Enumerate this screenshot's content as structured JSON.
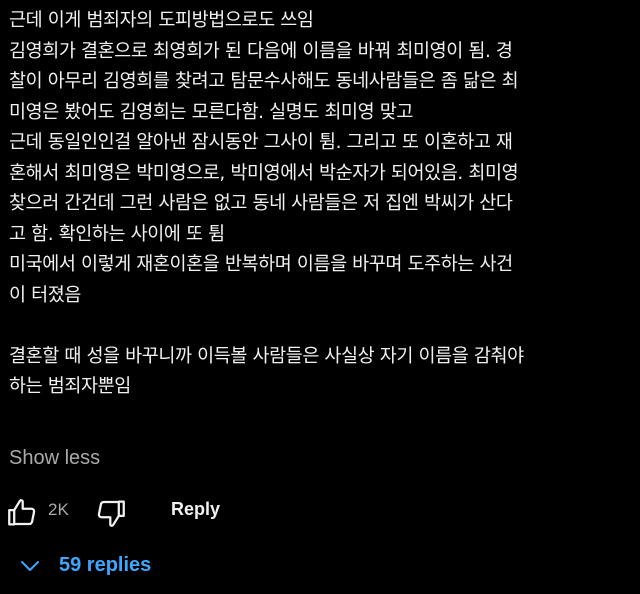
{
  "comment": {
    "lines": [
      "근데 이게 범죄자의 도피방법으로도 쓰임",
      "김영희가 결혼으로 최영희가 된 다음에 이름을 바꿔 최미영이 됨. 경",
      "찰이 아무리 김영희를 찾려고 탐문수사해도 동네사람들은 좀 닮은 최",
      "미영은 봤어도 김영희는 모른다함. 실명도 최미영 맞고",
      "근데 동일인인걸 알아낸 잠시동안 그사이 튐. 그리고 또 이혼하고 재",
      "혼해서 최미영은 박미영으로, 박미영에서 박순자가 되어있음. 최미영",
      "찾으러 간건데 그런 사람은 없고 동네 사람들은 저 집엔 박씨가 산다",
      "고 함. 확인하는 사이에 또 튐",
      "미국에서 이렇게 재혼이혼을 반복하며 이름을 바꾸며 도주하는 사건",
      "이 터졌음",
      "",
      "결혼할 때 성을 바꾸니까 이득볼 사람들은 사실상 자기 이름을 감춰야",
      "하는 범죄자뿐임"
    ],
    "show_less_label": "Show less"
  },
  "actions": {
    "like_icon": "thumbs-up-icon",
    "like_count": "2K",
    "dislike_icon": "thumbs-down-icon",
    "reply_label": "Reply"
  },
  "replies": {
    "toggle_icon": "chevron-down-icon",
    "label": "59 replies"
  },
  "colors": {
    "background": "#000000",
    "text": "#f1f1f1",
    "secondary": "#aaaaaa",
    "link": "#3ea6ff"
  }
}
